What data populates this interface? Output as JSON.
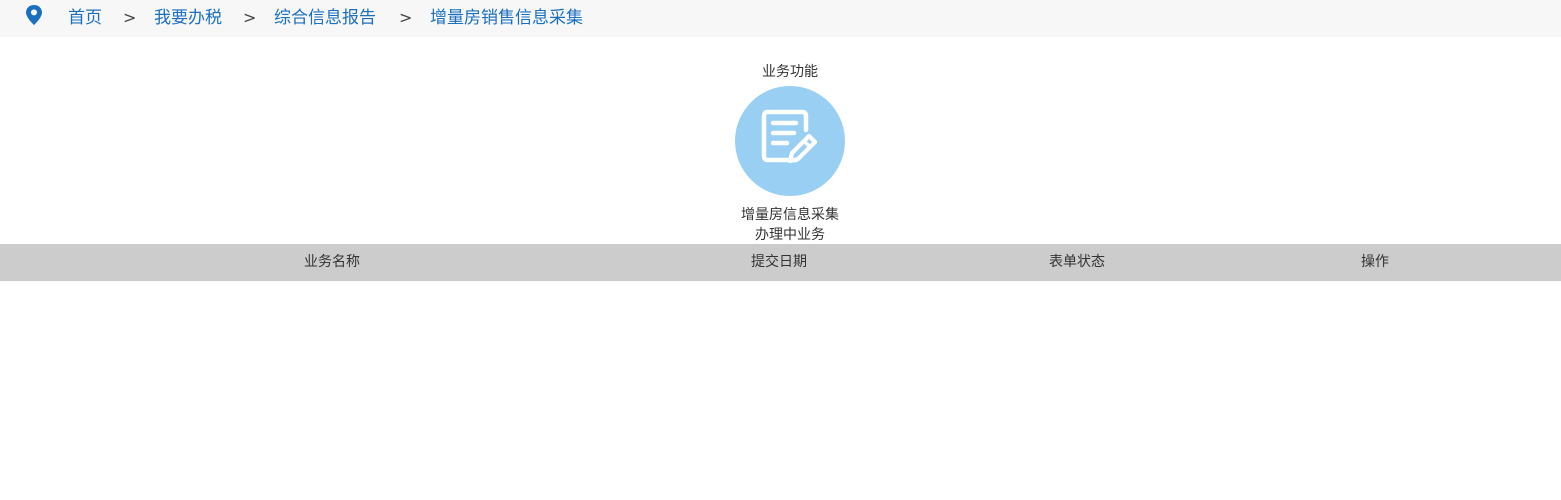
{
  "breadcrumb": {
    "icon": "location-pin-icon",
    "items": [
      "首页",
      "我要办税",
      "综合信息报告",
      "增量房销售信息采集"
    ],
    "separator": ">"
  },
  "functions": {
    "title": "业务功能",
    "items": [
      {
        "label": "增量房信息采集",
        "icon": "edit-document-icon",
        "color": "#99cff2"
      }
    ]
  },
  "in_progress": {
    "title": "办理中业务",
    "columns": [
      "业务名称",
      "提交日期",
      "表单状态",
      "操作"
    ],
    "rows": []
  },
  "colors": {
    "link": "#1a6fc0",
    "breadcrumb_bg": "#f7f7f7",
    "table_header_bg": "#cccccc",
    "icon_circle": "#99cff2"
  }
}
